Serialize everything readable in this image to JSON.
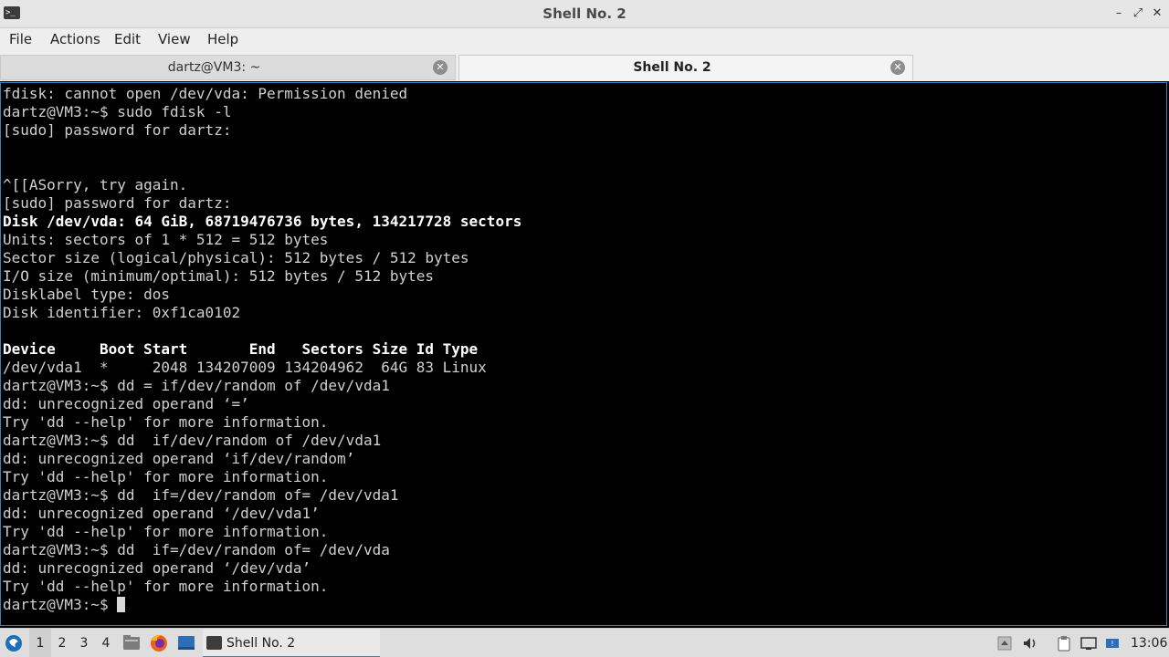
{
  "window": {
    "title": "Shell No. 2",
    "minimize": "–",
    "maximize": "⤢",
    "close": "✕"
  },
  "menu": [
    "File",
    "Actions",
    "Edit",
    "View",
    "Help"
  ],
  "tabs": [
    {
      "label": "dartz@VM3: ~",
      "close": "✕"
    },
    {
      "label": "Shell No. 2",
      "close": "✕"
    }
  ],
  "terminal": {
    "lines": [
      {
        "text": "fdisk: cannot open /dev/vda: Permission denied",
        "bold": false
      },
      {
        "text": "dartz@VM3:~$ sudo fdisk -l",
        "bold": false
      },
      {
        "text": "[sudo] password for dartz:",
        "bold": false
      },
      {
        "text": "",
        "bold": false
      },
      {
        "text": "",
        "bold": false
      },
      {
        "text": "^[[ASorry, try again.",
        "bold": false
      },
      {
        "text": "[sudo] password for dartz:",
        "bold": false
      },
      {
        "text": "Disk /dev/vda: 64 GiB, 68719476736 bytes, 134217728 sectors",
        "bold": true
      },
      {
        "text": "Units: sectors of 1 * 512 = 512 bytes",
        "bold": false
      },
      {
        "text": "Sector size (logical/physical): 512 bytes / 512 bytes",
        "bold": false
      },
      {
        "text": "I/O size (minimum/optimal): 512 bytes / 512 bytes",
        "bold": false
      },
      {
        "text": "Disklabel type: dos",
        "bold": false
      },
      {
        "text": "Disk identifier: 0xf1ca0102",
        "bold": false
      },
      {
        "text": "",
        "bold": false
      },
      {
        "text": "Device     Boot Start       End   Sectors Size Id Type",
        "bold": true
      },
      {
        "text": "/dev/vda1  *     2048 134207009 134204962  64G 83 Linux",
        "bold": false
      },
      {
        "text": "dartz@VM3:~$ dd = if/dev/random of /dev/vda1",
        "bold": false
      },
      {
        "text": "dd: unrecognized operand ‘=’",
        "bold": false
      },
      {
        "text": "Try 'dd --help' for more information.",
        "bold": false
      },
      {
        "text": "dartz@VM3:~$ dd  if/dev/random of /dev/vda1",
        "bold": false
      },
      {
        "text": "dd: unrecognized operand ‘if/dev/random’",
        "bold": false
      },
      {
        "text": "Try 'dd --help' for more information.",
        "bold": false
      },
      {
        "text": "dartz@VM3:~$ dd  if=/dev/random of= /dev/vda1",
        "bold": false
      },
      {
        "text": "dd: unrecognized operand ‘/dev/vda1’",
        "bold": false
      },
      {
        "text": "Try 'dd --help' for more information.",
        "bold": false
      },
      {
        "text": "dartz@VM3:~$ dd  if=/dev/random of= /dev/vda",
        "bold": false
      },
      {
        "text": "dd: unrecognized operand ‘/dev/vda’",
        "bold": false
      },
      {
        "text": "Try 'dd --help' for more information.",
        "bold": false
      }
    ],
    "prompt": "dartz@VM3:~$ "
  },
  "taskbar": {
    "workspaces": [
      "1",
      "2",
      "3",
      "4"
    ],
    "active_workspace": "1",
    "task_label": "Shell No. 2",
    "clock": "13:06"
  },
  "icons": {
    "start": "start-menu-icon",
    "files": "file-manager-icon",
    "browser": "firefox-icon",
    "desktop": "show-desktop-icon",
    "tray": [
      "tray-arrow-icon",
      "volume-icon",
      "clipboard-icon",
      "network-icon",
      "update-icon"
    ]
  },
  "colors": {
    "accent": "#3c80b8",
    "terminal_bg": "#000000",
    "terminal_fg": "#d0d0d0"
  }
}
